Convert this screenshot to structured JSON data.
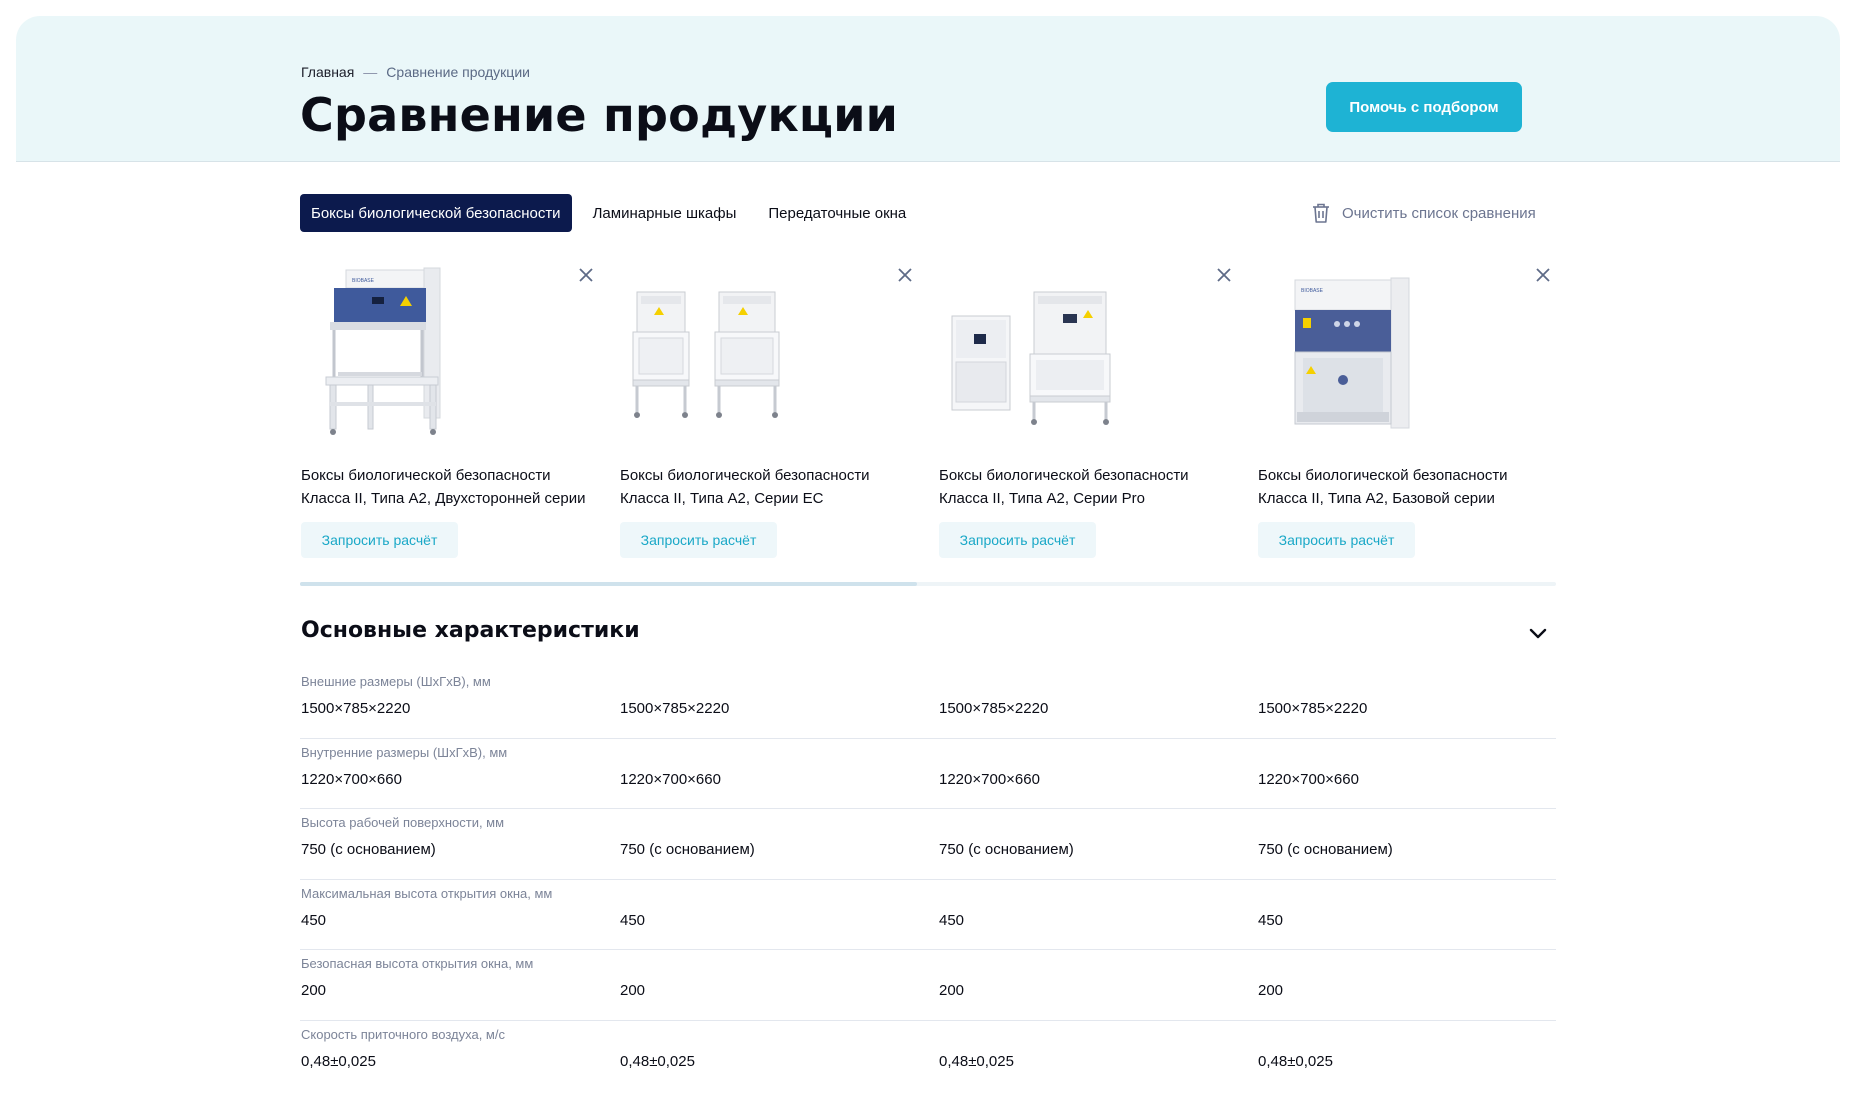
{
  "breadcrumb": {
    "home": "Главная",
    "separator": "—",
    "current": "Сравнение продукции"
  },
  "header": {
    "title": "Сравнение продукции",
    "help_button": "Помочь с подбором"
  },
  "tabs": [
    {
      "label": "Боксы биологической безопасности",
      "active": true
    },
    {
      "label": "Ламинарные шкафы",
      "active": false
    },
    {
      "label": "Передаточные окна",
      "active": false
    }
  ],
  "clear_list": {
    "label": "Очистить список сравнения",
    "icon": "trash-icon"
  },
  "products": [
    {
      "name_line1": "Боксы биологической безопасности",
      "name_line2": "Класса II, Типа А2, Двухсторонней серии",
      "request": "Запросить расчёт"
    },
    {
      "name_line1": "Боксы биологической безопасности",
      "name_line2": "Класса II, Типа А2, Серии ЕС",
      "request": "Запросить расчёт"
    },
    {
      "name_line1": "Боксы биологической безопасности",
      "name_line2": "Класса II, Типа А2, Серии Pro",
      "request": "Запросить расчёт"
    },
    {
      "name_line1": "Боксы биологической безопасности",
      "name_line2": "Класса II, Типа А2, Базовой серии",
      "request": "Запросить расчёт"
    }
  ],
  "section": {
    "title": "Основные характеристики"
  },
  "specs": [
    {
      "label": "Внешние размеры (ШхГхВ), мм",
      "values": [
        "1500×785×2220",
        "1500×785×2220",
        "1500×785×2220",
        "1500×785×2220"
      ]
    },
    {
      "label": "Внутренние размеры (ШхГхВ), мм",
      "values": [
        "1220×700×660",
        "1220×700×660",
        "1220×700×660",
        "1220×700×660"
      ]
    },
    {
      "label": "Высота рабочей поверхности, мм",
      "values": [
        "750 (с основанием)",
        "750 (с основанием)",
        "750 (с основанием)",
        "750 (с основанием)"
      ]
    },
    {
      "label": "Максимальная высота открытия окна, мм",
      "values": [
        "450",
        "450",
        "450",
        "450"
      ]
    },
    {
      "label": "Безопасная высота открытия окна, мм",
      "values": [
        "200",
        "200",
        "200",
        "200"
      ]
    },
    {
      "label": "Скорость приточного воздуха, м/с",
      "values": [
        "0,48±0,025",
        "0,48±0,025",
        "0,48±0,025",
        "0,48±0,025"
      ]
    }
  ],
  "colors": {
    "accent": "#1eb3d4",
    "tab_active_bg": "#0c1a4d",
    "hero_bg": "#eaf7f9",
    "cabinet_blue": "#3f5a9c"
  }
}
